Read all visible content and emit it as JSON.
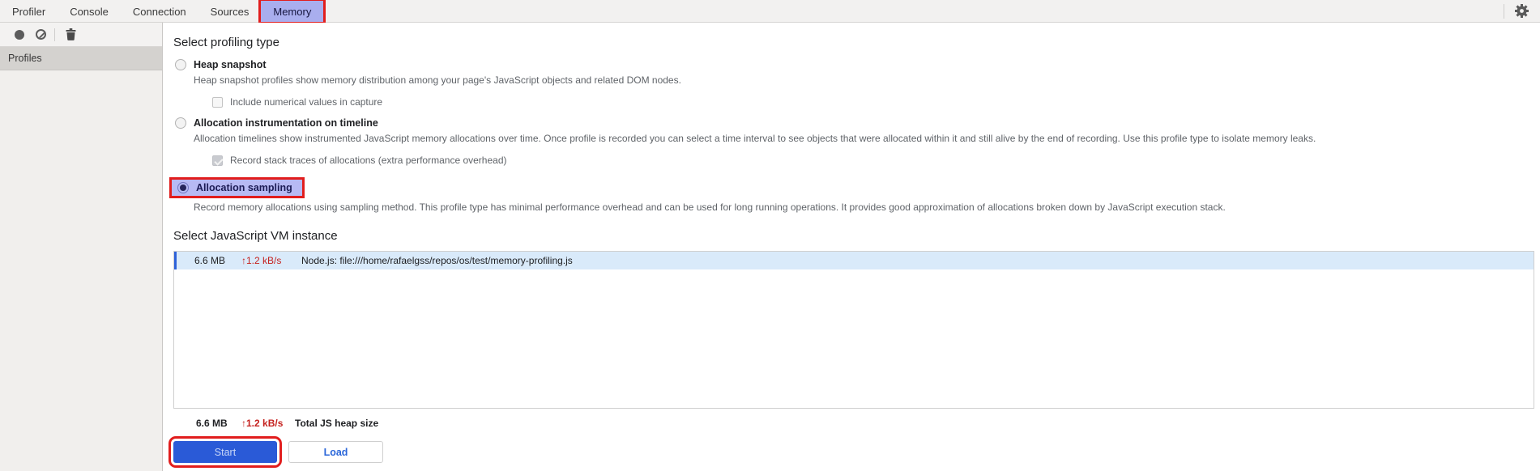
{
  "topbar": {
    "tabs": [
      {
        "label": "Profiler",
        "active": false
      },
      {
        "label": "Console",
        "active": false
      },
      {
        "label": "Connection",
        "active": false
      },
      {
        "label": "Sources",
        "active": false
      },
      {
        "label": "Memory",
        "active": true,
        "annotated": true
      }
    ]
  },
  "toolbar": {
    "record_icon": "record-icon",
    "clear_icon": "clear-icon",
    "trash_icon": "trash-icon"
  },
  "sidebar": {
    "header": "Profiles"
  },
  "main": {
    "profiling_heading": "Select profiling type",
    "options": {
      "heap": {
        "label": "Heap snapshot",
        "selected": false,
        "description": "Heap snapshot profiles show memory distribution among your page's JavaScript objects and related DOM nodes.",
        "checkbox_label": "Include numerical values in capture",
        "checkbox_checked": false
      },
      "timeline": {
        "label": "Allocation instrumentation on timeline",
        "selected": false,
        "description": "Allocation timelines show instrumented JavaScript memory allocations over time. Once profile is recorded you can select a time interval to see objects that were allocated within it and still alive by the end of recording. Use this profile type to isolate memory leaks.",
        "checkbox_label": "Record stack traces of allocations (extra performance overhead)",
        "checkbox_checked": true,
        "checkbox_disabled": true
      },
      "sampling": {
        "label": "Allocation sampling",
        "selected": true,
        "annotated": true,
        "description": "Record memory allocations using sampling method. This profile type has minimal performance overhead and can be used for long running operations. It provides good approximation of allocations broken down by JavaScript execution stack."
      }
    },
    "vm_heading": "Select JavaScript VM instance",
    "vm_row": {
      "size": "6.6 MB",
      "rate": "↑1.2 kB/s",
      "title": "Node.js: file:///home/rafaelgss/repos/os/test/memory-profiling.js",
      "selected": true
    },
    "total_row": {
      "size": "6.6 MB",
      "rate": "↑1.2 kB/s",
      "label": "Total JS heap size"
    },
    "buttons": {
      "start": "Start",
      "load": "Load",
      "start_annotated": true
    }
  },
  "colors": {
    "annotation_red": "#e11d1d",
    "tab_highlight": "#a9aeee",
    "sampling_highlight": "#b7baf4",
    "accent_blue": "#2a5ad7",
    "selected_row_bg": "#d9eafa",
    "rate_red": "#c5221f"
  }
}
